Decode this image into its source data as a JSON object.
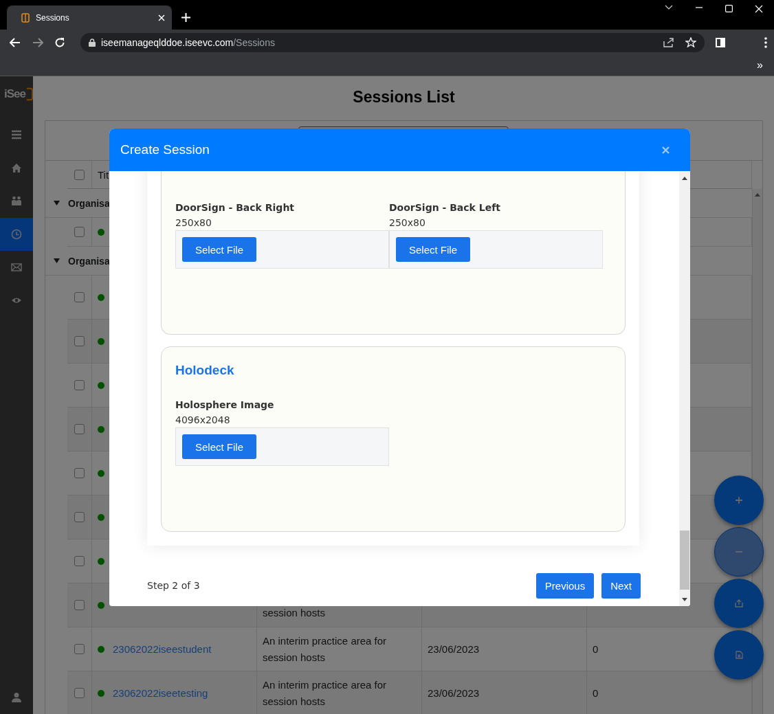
{
  "browser": {
    "tab_title": "Sessions",
    "url_host": "iseemanageqlddoe.iseevc.com",
    "url_path": "/Sessions",
    "bookmarks_overflow": "»"
  },
  "sidebar": {
    "logo": "iSee",
    "items": [
      {
        "kind": "menu",
        "selected": false
      },
      {
        "kind": "home",
        "selected": false
      },
      {
        "kind": "people",
        "selected": false
      },
      {
        "kind": "clock",
        "selected": true
      },
      {
        "kind": "mail",
        "selected": false
      },
      {
        "kind": "eye",
        "selected": false
      }
    ],
    "footer_item": {
      "kind": "user",
      "selected": false
    }
  },
  "page": {
    "title": "Sessions List"
  },
  "table": {
    "header": {
      "checked": false,
      "column_2": "Tit"
    },
    "groups": [
      {
        "label": "Organisa",
        "expanded": true,
        "rows": [
          {
            "checked": false
          }
        ]
      },
      {
        "label": "Organisa",
        "expanded": true,
        "rows": [
          {
            "checked": false
          },
          {
            "checked": false
          },
          {
            "checked": false
          },
          {
            "checked": false
          },
          {
            "checked": false
          },
          {
            "checked": false
          },
          {
            "checked": false
          },
          {
            "checked": false,
            "kind": "partial",
            "description": "session hosts"
          },
          {
            "checked": false,
            "kind": "full",
            "title": "23062022iseestudent",
            "description": "An interim practice area for session hosts",
            "date": "23/06/2023",
            "count": "0"
          },
          {
            "checked": false,
            "kind": "full",
            "title": "23062022iseetesting",
            "description": "An interim practice area for session hosts",
            "date": "23/06/2023",
            "count": "0"
          }
        ]
      }
    ]
  },
  "fabs": [
    {
      "kind": "add",
      "disabled": false
    },
    {
      "kind": "remove",
      "disabled": true
    },
    {
      "kind": "export",
      "disabled": false
    },
    {
      "kind": "excel",
      "disabled": false
    }
  ],
  "modal": {
    "title": "Create Session",
    "sections": [
      {
        "fields": [
          {
            "label": "DoorSign - Back Right",
            "size": "250x80",
            "button": "Select File"
          },
          {
            "label": "DoorSign - Back Left",
            "size": "250x80",
            "button": "Select File"
          }
        ]
      },
      {
        "heading": "Holodeck",
        "fields": [
          {
            "label": "Holosphere Image",
            "size": "4096x2048",
            "button": "Select File"
          }
        ]
      }
    ],
    "step": "Step 2 of 3",
    "buttons": [
      "Previous",
      "Next"
    ]
  }
}
